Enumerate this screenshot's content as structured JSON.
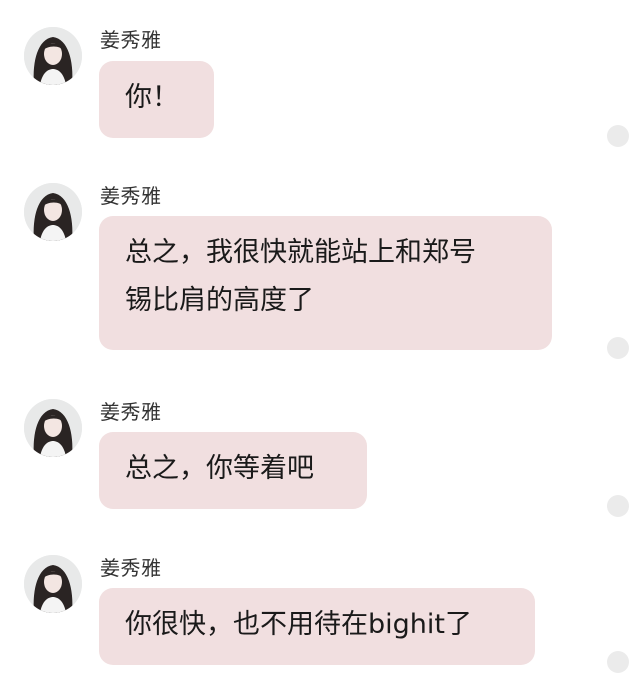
{
  "messages": [
    {
      "sender": "姜秀雅",
      "text": "你！"
    },
    {
      "sender": "姜秀雅",
      "text": "总之，我很快就能站上和郑号\n锡比肩的高度了"
    },
    {
      "sender": "姜秀雅",
      "text": "总之，你等着吧"
    },
    {
      "sender": "姜秀雅",
      "text": "你很快，也不用待在bighit了"
    }
  ],
  "colors": {
    "bubble_background": "#f1dfe0",
    "status_dot": "#ebebeb",
    "sender_text": "#333333",
    "message_text": "#1a1a1a"
  },
  "icons": {
    "avatar": "user-avatar-photo",
    "status": "read-status-dot-icon"
  }
}
